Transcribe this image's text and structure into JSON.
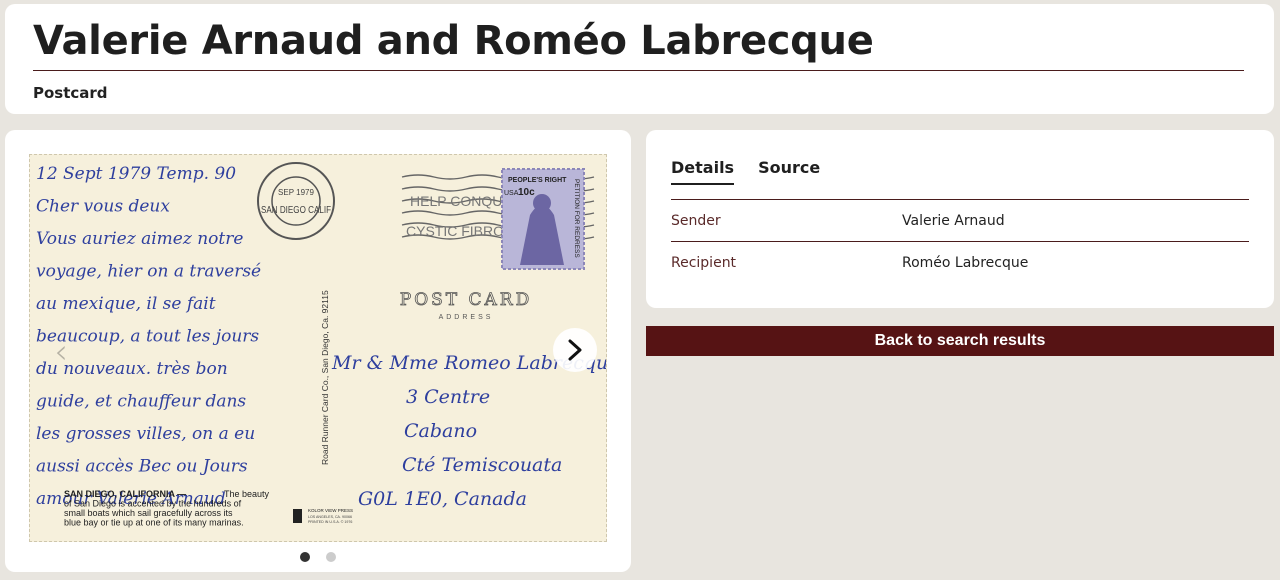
{
  "header": {
    "title": "Valerie Arnaud and Roméo Labrecque",
    "subtitle": "Postcard"
  },
  "postcard": {
    "handwritten_lines": [
      "12 Sept 1979  Temp. 90",
      "Cher vous deux",
      "Vous auriez aimez notre",
      "voyage, hier on a traversé",
      "au mexique, il se fait",
      "beaucoup, a tout les jours",
      "du nouveaux. très bon",
      "guide, et chauffeur dans",
      "les grosses villes, on a eu",
      "aussi accès Bec ou Jours",
      "amour  Valerie Arnaud"
    ],
    "caption_heading": "SAN DIEGO, CALIFORNIA —",
    "caption_lines": [
      "The beauty",
      "of San Diego is accented by the hundreds of",
      "small boats which sail gracefully across its",
      "blue bay or tie up at one of its many marinas."
    ],
    "publisher": "Road Runner Card Co., San Diego, Ca. 92115",
    "post_card_heading": "POST CARD",
    "address_label": "ADDRESS",
    "stamp_top": "PEOPLE'S RIGHT",
    "stamp_value": "10c",
    "stamp_country": "USA",
    "stamp_side": "PETITION FOR REDRESS",
    "postmark_city": "SAN DIEGO CALIF",
    "postmark_date": "SEP 1979",
    "cancel_text_1": "HELP CONQUER",
    "cancel_text_2": "CYSTIC FIBROSIS",
    "address_lines": [
      "Mr & Mme Romeo Labrecque",
      "3 Centre",
      "Cabano",
      "Cté Temiscouata",
      "G0L 1E0, Canada"
    ],
    "logo_text": "KOLOR VIEW PRESS",
    "logo_sub": "LOS ANGELES, CA. 90066",
    "logo_year": "PRINTED IN U.S.A. © 1976"
  },
  "carousel": {
    "dots": 2,
    "active_index": 0
  },
  "details": {
    "tabs": [
      {
        "label": "Details",
        "active": true
      },
      {
        "label": "Source",
        "active": false
      }
    ],
    "rows": [
      {
        "label": "Sender",
        "value": "Valerie Arnaud"
      },
      {
        "label": "Recipient",
        "value": "Roméo Labrecque"
      }
    ]
  },
  "actions": {
    "back_label": "Back to search results"
  },
  "colors": {
    "page_bg": "#e8e5df",
    "accent": "#561314",
    "ink": "#2e3f9e"
  }
}
